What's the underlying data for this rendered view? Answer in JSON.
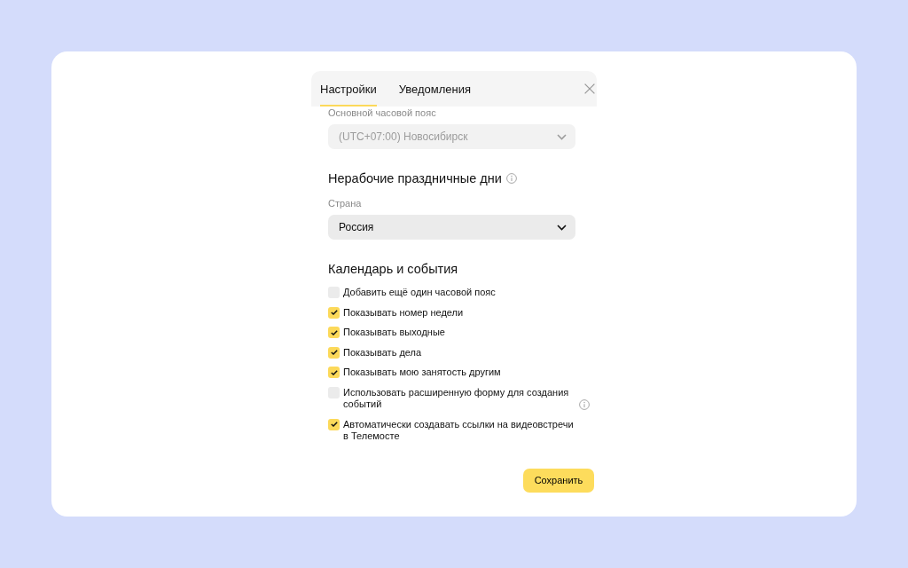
{
  "tabs": [
    {
      "label": "Настройки",
      "selected": true
    },
    {
      "label": "Уведомления",
      "selected": false
    }
  ],
  "timezone": {
    "label": "Основной часовой пояс",
    "value": "(UTC+07:00) Новосибирск",
    "disabled": true
  },
  "holidays": {
    "title": "Нерабочие праздничные дни",
    "info": true,
    "country": {
      "label": "Страна",
      "value": "Россия",
      "disabled": false
    }
  },
  "calendar": {
    "title": "Календарь и события",
    "options": [
      {
        "label": "Добавить ещё один часовой пояс",
        "checked": false,
        "info": false
      },
      {
        "label": "Показывать номер недели",
        "checked": true,
        "info": false
      },
      {
        "label": "Показывать выходные",
        "checked": true,
        "info": false
      },
      {
        "label": "Показывать дела",
        "checked": true,
        "info": false
      },
      {
        "label": "Показывать мою занятость другим",
        "checked": true,
        "info": false
      },
      {
        "label": "Использовать расширенную форму для создания событий",
        "checked": false,
        "info": true
      },
      {
        "label": "Автоматически создавать ссылки на видеовстречи в Телемосте",
        "checked": true,
        "info": false
      }
    ]
  },
  "save_button": "Сохранить"
}
